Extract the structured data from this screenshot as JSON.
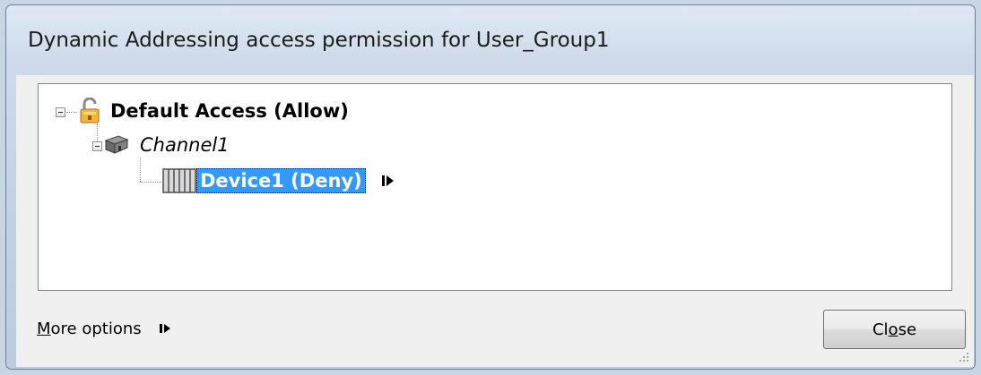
{
  "window": {
    "title": "Dynamic Addressing access permission for User_Group1"
  },
  "tree": {
    "root": {
      "label": "Default Access (Allow)",
      "icon": "unlocked-padlock-icon"
    },
    "channel": {
      "label": "Channel1",
      "icon": "channel-icon"
    },
    "device": {
      "label": "Device1 (Deny)",
      "icon": "device-icon"
    }
  },
  "footer": {
    "more_options_first": "M",
    "more_options_rest": "ore options",
    "close_before": "Cl",
    "close_underlined": "o",
    "close_after": "se"
  },
  "colors": {
    "selection": "#3399ff",
    "dialog_bg": "#f0f0f0",
    "frame": "#c8d5e3"
  }
}
